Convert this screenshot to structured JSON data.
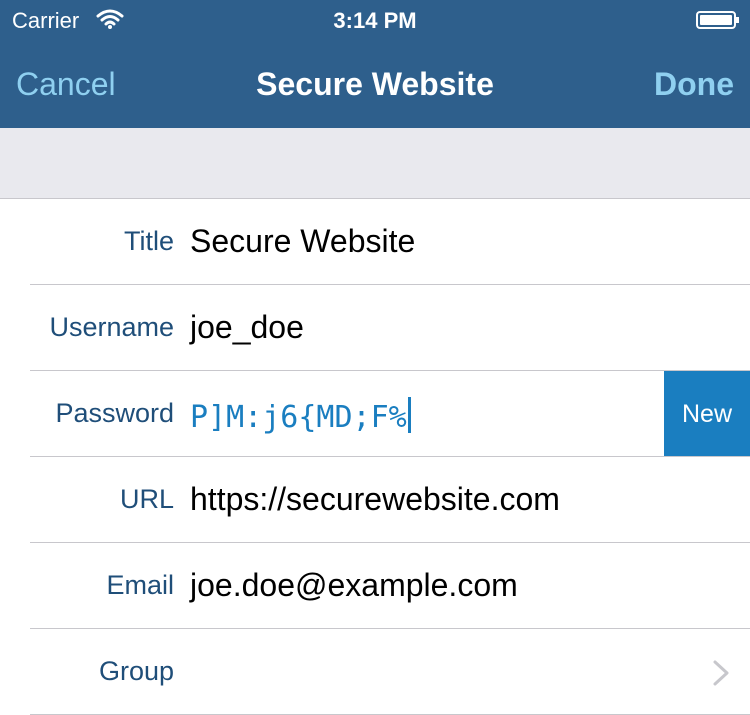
{
  "status_bar": {
    "carrier": "Carrier",
    "time": "3:14 PM",
    "wifi_icon": "wifi-icon",
    "battery_icon": "battery-icon"
  },
  "nav": {
    "cancel": "Cancel",
    "title": "Secure Website",
    "done": "Done"
  },
  "colors": {
    "nav_background": "#2e5f8c",
    "nav_button": "#8fd0f0",
    "label": "#1f4e79",
    "accent": "#1a7ec0",
    "section_background": "#e9e9ee"
  },
  "fields": {
    "title": {
      "label": "Title",
      "value": "Secure Website"
    },
    "username": {
      "label": "Username",
      "value": "joe_doe"
    },
    "password": {
      "label": "Password",
      "value": "P]M:j6{MD;F%",
      "new_button": "New"
    },
    "url": {
      "label": "URL",
      "value": "https://securewebsite.com"
    },
    "email": {
      "label": "Email",
      "value": "joe.doe@example.com"
    },
    "group": {
      "label": "Group",
      "icon": "chevron-right-icon"
    }
  }
}
